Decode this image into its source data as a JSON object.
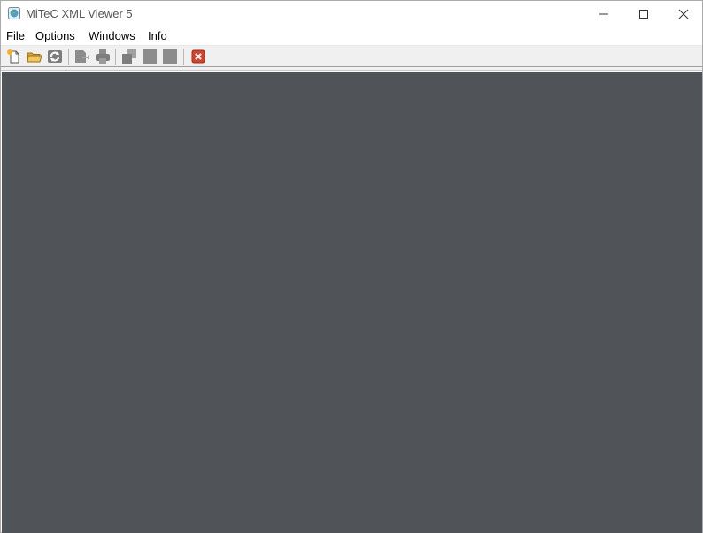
{
  "window": {
    "title": "MiTeC XML Viewer 5",
    "icon": "app-globe-icon"
  },
  "window_controls": {
    "minimize": "minimize-icon",
    "maximize": "maximize-icon",
    "close": "close-icon"
  },
  "menu": {
    "items": [
      {
        "label": "File"
      },
      {
        "label": "Options"
      },
      {
        "label": "Windows"
      },
      {
        "label": "Info"
      }
    ]
  },
  "toolbar": {
    "buttons": [
      {
        "icon": "new-document-icon",
        "enabled": true
      },
      {
        "icon": "open-folder-icon",
        "enabled": true
      },
      {
        "icon": "refresh-icon",
        "enabled": true
      },
      {
        "icon": "export-icon",
        "enabled": false
      },
      {
        "icon": "print-icon",
        "enabled": false
      },
      {
        "icon": "cascade-windows-icon",
        "enabled": false
      },
      {
        "icon": "tile-horizontal-icon",
        "enabled": false
      },
      {
        "icon": "tile-vertical-icon",
        "enabled": false
      },
      {
        "icon": "close-all-icon",
        "enabled": true
      }
    ]
  },
  "colors": {
    "workspace": "#505358",
    "toolbar": "#f0f0f0",
    "close_all": "#d9402b"
  }
}
